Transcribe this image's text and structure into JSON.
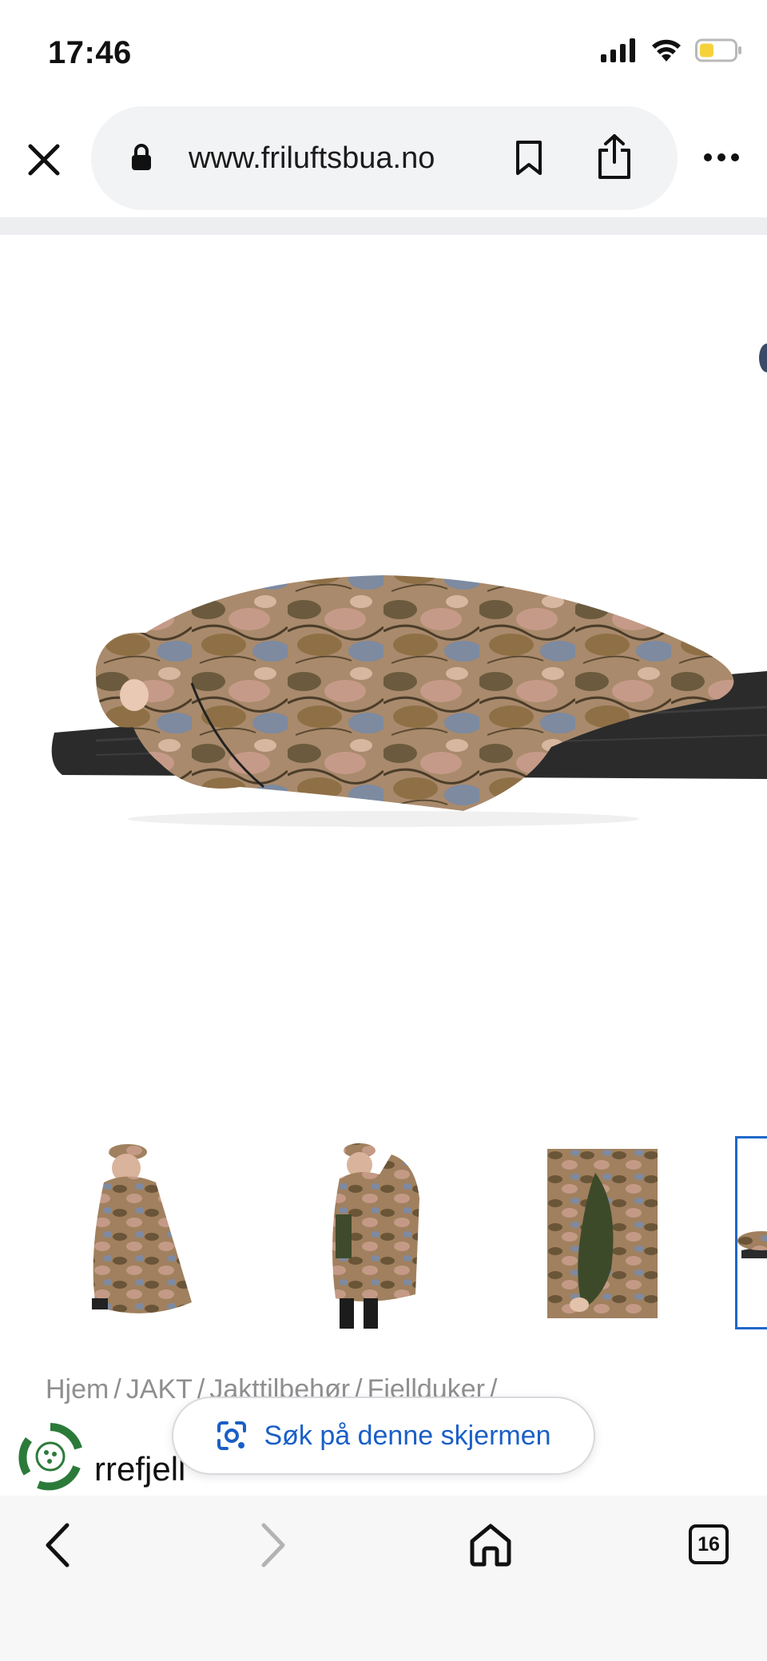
{
  "status_bar": {
    "time": "17:46",
    "icons": [
      "cellular-signal-icon",
      "wifi-icon",
      "battery-icon"
    ],
    "battery_color": "#f5d23c"
  },
  "browser": {
    "url": "www.friluftsbua.no",
    "icons": [
      "close-icon",
      "lock-icon",
      "bookmark-icon",
      "share-icon",
      "more-icon"
    ]
  },
  "product": {
    "gallery_count": 4,
    "thumbnails": [
      {
        "name": "sitting-in-poncho"
      },
      {
        "name": "standing-in-poncho-with-pack"
      },
      {
        "name": "poncho-sleeve-detail"
      },
      {
        "name": "lying-on-mat-selected"
      }
    ],
    "breadcrumb": [
      "Hjem",
      "JAKT",
      "Jakttilbehør",
      "Fjellduker",
      ""
    ],
    "title_partial": "rrefjell"
  },
  "lens": {
    "label": "Søk på denne skjermen",
    "accent": "#1a5fc7"
  },
  "bottom_nav": {
    "tabs_count": "16",
    "icons": [
      "back-icon",
      "forward-icon",
      "home-icon",
      "tabs-icon"
    ]
  }
}
